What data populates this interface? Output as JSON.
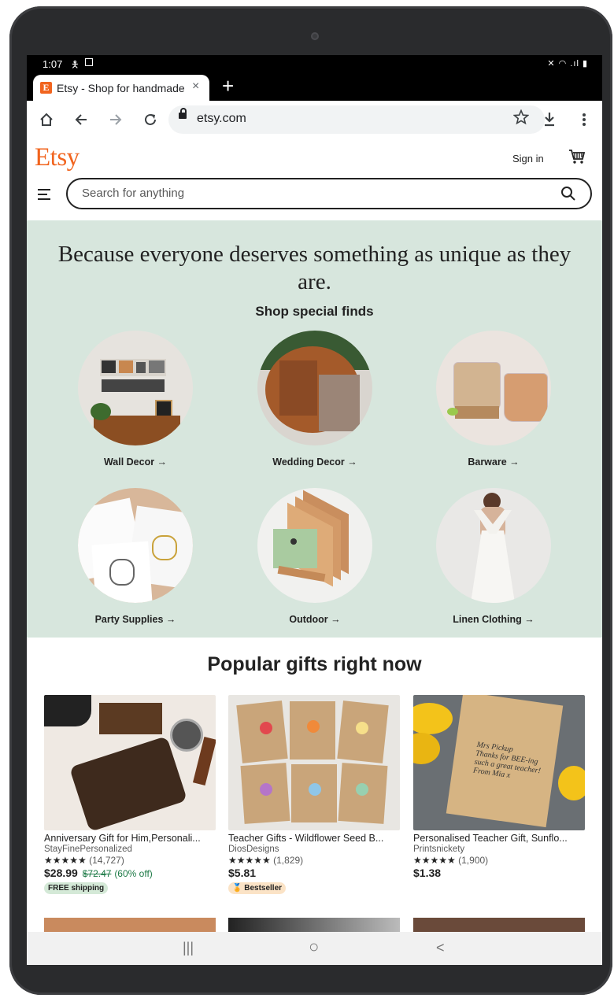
{
  "status_bar": {
    "time": "1:07",
    "right_icons": "✕ ◠ .ıl ▮"
  },
  "browser": {
    "tab": {
      "favicon": "E",
      "title": "Etsy - Shop for handmade",
      "close": "×"
    },
    "new_tab": "+",
    "url": "etsy.com",
    "icons": [
      "home-icon",
      "back-icon",
      "forward-icon",
      "reload-icon",
      "lock-icon",
      "star-icon",
      "download-icon",
      "more-icon"
    ]
  },
  "header": {
    "logo": "Etsy",
    "sign_in": "Sign in",
    "search_placeholder": "Search for anything"
  },
  "hero": {
    "title": "Because everyone deserves something as unique as they are.",
    "subtitle": "Shop special finds",
    "categories": [
      {
        "label": "Wall Decor →"
      },
      {
        "label": "Wedding Decor →"
      },
      {
        "label": "Barware →"
      },
      {
        "label": "Party Supplies →"
      },
      {
        "label": "Outdoor →"
      },
      {
        "label": "Linen Clothing →"
      }
    ]
  },
  "popular": {
    "title": "Popular gifts right now",
    "items": [
      {
        "title": "Anniversary Gift for Him,Personali...",
        "shop": "StayFinePersonalized",
        "stars": "★★★★★",
        "reviews": "(14,727)",
        "price": "$28.99",
        "old_price": "$72.47",
        "discount": "(60% off)",
        "badge": "FREE shipping"
      },
      {
        "title": "Teacher Gifts - Wildflower Seed B...",
        "shop": "DiosDesigns",
        "stars": "★★★★★",
        "reviews": "(1,829)",
        "price": "$5.81",
        "badge": "Bestseller"
      },
      {
        "title": "Personalised Teacher Gift, Sunflo...",
        "shop": "Printsnickety",
        "stars": "★★★★★",
        "reviews": "(1,900)",
        "price": "$1.38"
      }
    ],
    "card3_image_text": "Mrs Pickup\nThanks for BEE-ing such a great teacher!\nFrom Mia x"
  },
  "navbar": {
    "recent": "|||",
    "home": "○",
    "back": "<"
  }
}
